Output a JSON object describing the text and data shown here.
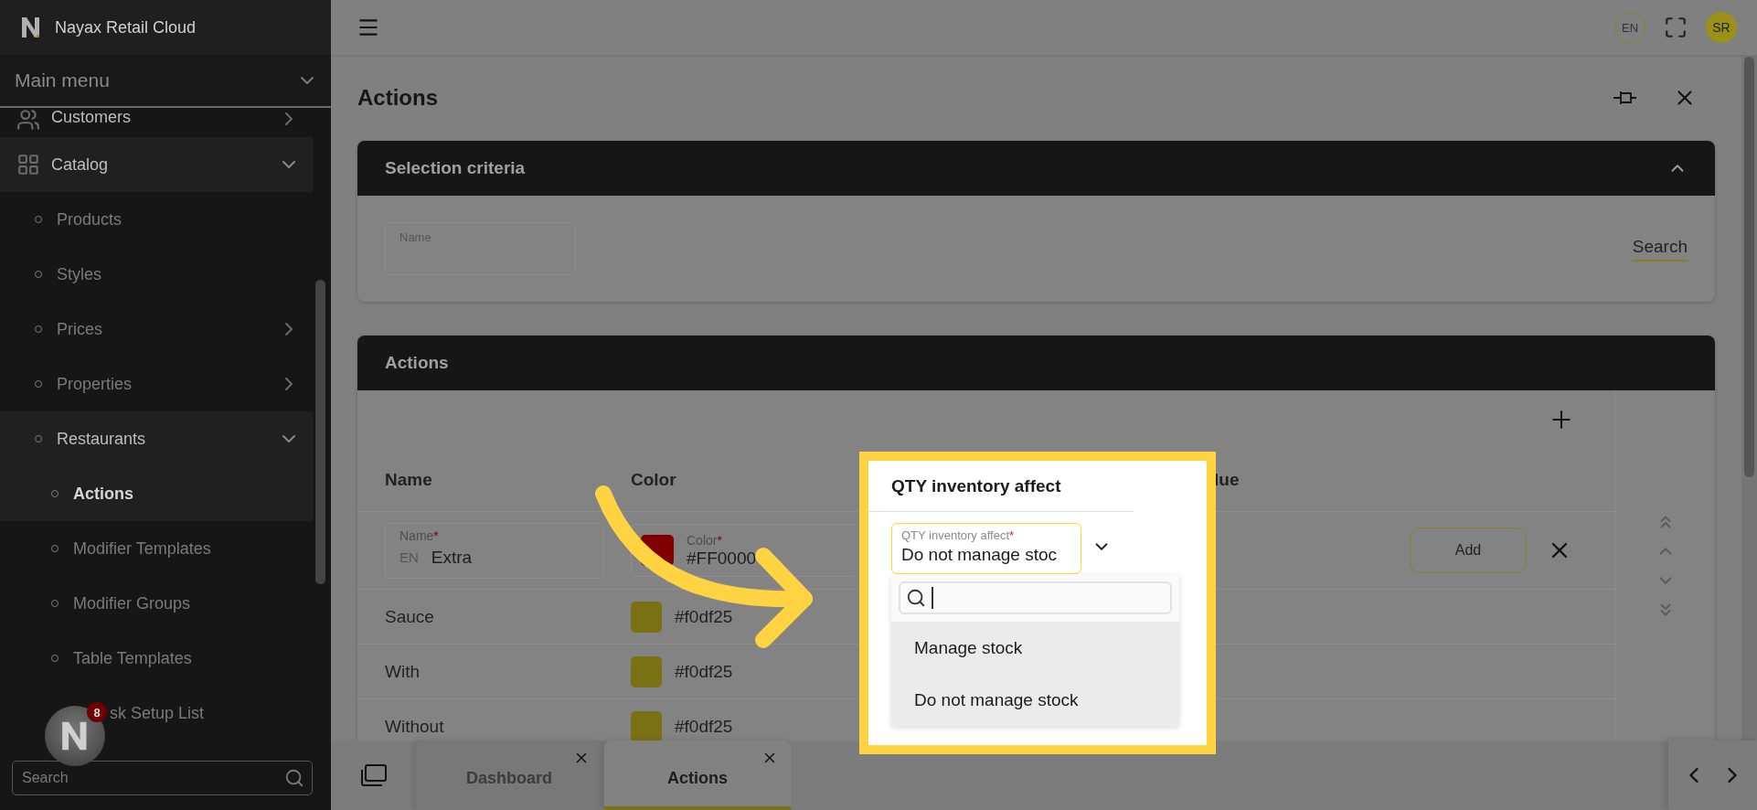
{
  "app": {
    "brand": "Nayax Retail Cloud",
    "language": "EN",
    "user_initials": "SR"
  },
  "sidebar": {
    "menu_title": "Main menu",
    "search_placeholder": "Search",
    "notification_badge": "8",
    "items": [
      {
        "label": "Customers",
        "kind": "section",
        "expanded": false,
        "selected": false
      },
      {
        "label": "Catalog",
        "kind": "section",
        "expanded": true,
        "selected": false,
        "children": [
          {
            "label": "Products",
            "selected": false
          },
          {
            "label": "Styles",
            "selected": false
          },
          {
            "label": "Prices",
            "expanded": false,
            "selected": false
          },
          {
            "label": "Properties",
            "expanded": false,
            "selected": false
          },
          {
            "label": "Restaurants",
            "expanded": true,
            "selected": false,
            "children": [
              {
                "label": "Actions",
                "selected": true
              },
              {
                "label": "Modifier Templates",
                "selected": false
              },
              {
                "label": "Modifier Groups",
                "selected": false
              },
              {
                "label": "Table Templates",
                "selected": false
              },
              {
                "label": "sk Setup List",
                "kind": "covered",
                "selected": false
              }
            ]
          }
        ]
      }
    ]
  },
  "page": {
    "title": "Actions"
  },
  "selection_criteria": {
    "title": "Selection criteria",
    "expanded": true,
    "field_label": "Name",
    "search_button": "Search"
  },
  "actions_panel": {
    "title": "Actions",
    "columns": [
      "Name",
      "Color",
      "QTY inventory affect",
      "lue"
    ],
    "edit_row": {
      "name_label": "Name",
      "required_mark": "*",
      "language": "EN",
      "name": "Extra",
      "color_label": "Color",
      "color": "#800000",
      "color_text": "#FF0000",
      "qty_label": "QTY inventory affect",
      "qty_value": "Do not manage stoc",
      "add_button": "Add"
    },
    "rows": [
      {
        "name": "Sauce",
        "color": "#7a7014",
        "color_text": "#f0df25"
      },
      {
        "name": "With",
        "color": "#7a7014",
        "color_text": "#f0df25"
      },
      {
        "name": "Without",
        "color": "#7a7014",
        "color_text": "#f0df25"
      }
    ],
    "dropdown": {
      "options": [
        "Manage stock",
        "Do not manage stock"
      ]
    }
  },
  "tabs": [
    {
      "label": "Dashboard",
      "selected": false
    },
    {
      "label": "Actions",
      "selected": true
    }
  ]
}
